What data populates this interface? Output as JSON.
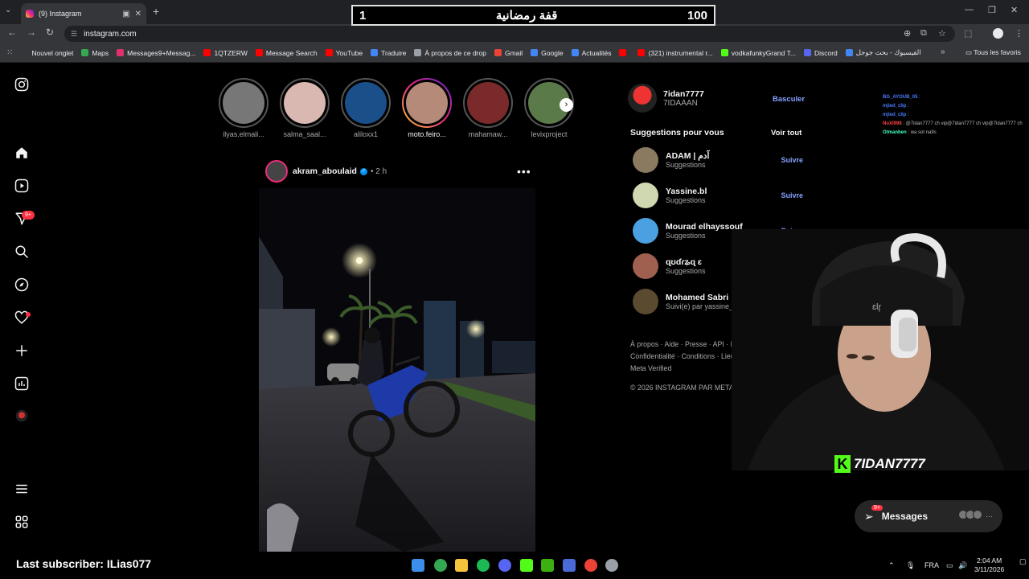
{
  "browser": {
    "tab_title": "(9) Instagram",
    "url": "instagram.com",
    "bookmarks": [
      {
        "label": "Nouvel onglet",
        "color": "#35363a"
      },
      {
        "label": "Maps",
        "color": "#34a853"
      },
      {
        "label": "Messages9+Messag...",
        "color": "#e1306c"
      },
      {
        "label": "1QTZERW",
        "color": "#ff0000"
      },
      {
        "label": "Message Search",
        "color": "#ff0000"
      },
      {
        "label": "YouTube",
        "color": "#ff0000"
      },
      {
        "label": "Traduire",
        "color": "#4285f4"
      },
      {
        "label": "À propos de ce drop",
        "color": "#9aa0a6"
      },
      {
        "label": "Gmail",
        "color": "#ea4335"
      },
      {
        "label": "Google",
        "color": "#4285f4"
      },
      {
        "label": "Actualités",
        "color": "#4285f4"
      },
      {
        "label": "",
        "color": "#ff0000"
      },
      {
        "label": "(321) instrumental r...",
        "color": "#ff0000"
      },
      {
        "label": "vodkafunkyGrand T...",
        "color": "#53fc18"
      },
      {
        "label": "Discord",
        "color": "#5865f2"
      },
      {
        "label": "الفيسبوك - بحث جوجل",
        "color": "#4285f4"
      }
    ],
    "all_bookmarks": "Tous les favoris"
  },
  "overlay": {
    "goal_left": "1",
    "goal_title": "قفة رمضانية",
    "goal_right": "100",
    "last_subscriber": "Last subscriber: ILias077",
    "streamer_name": "7IDAN7777"
  },
  "sidebar": {
    "notif_badge": "9+"
  },
  "stories": [
    {
      "name": "ilyas.elmali...",
      "active": false,
      "color": "#777"
    },
    {
      "name": "salma_saal...",
      "active": false,
      "color": "#d8b8b0"
    },
    {
      "name": "aliloxx1",
      "active": false,
      "color": "#1b4f8a"
    },
    {
      "name": "moto.feiro...",
      "active": true,
      "color": "#b58a78"
    },
    {
      "name": "mahamaw...",
      "active": false,
      "color": "#7a2a2a"
    },
    {
      "name": "levixproject",
      "active": false,
      "color": "#5a7a4a"
    }
  ],
  "post": {
    "username": "akram_aboulaid",
    "time": "2 h"
  },
  "profile": {
    "username": "7idan7777",
    "fullname": "7IDAAAN",
    "switch": "Basculer"
  },
  "suggestions": {
    "title": "Suggestions pour vous",
    "see_all": "Voir tout",
    "items": [
      {
        "name": "ADAM | آدم",
        "sub": "Suggestions",
        "color": "#8a7a60"
      },
      {
        "name": "Yassine.bl",
        "sub": "Suggestions",
        "color": "#cfd8b0"
      },
      {
        "name": "Mourad elhayssouf",
        "sub": "Suggestions",
        "color": "#4aa0e0"
      },
      {
        "name": "ɋʊɗɾʑɋ ɛ",
        "sub": "Suggestions",
        "color": "#a06050"
      },
      {
        "name": "Mohamed Sabri",
        "sub": "Suivi(e) par yassine_alahian +",
        "color": "#5a4a30"
      }
    ],
    "follow": "Suivre"
  },
  "footer": {
    "links": "À propos · Aide · Presse · API · Emplois · Confidentialité · Conditions · Lieux · Langue · Meta Verified",
    "copyright": "© 2026 INSTAGRAM PAR META"
  },
  "chat": [
    {
      "user": "BG_AYOUB_05",
      "msg": "",
      "cls": "n1"
    },
    {
      "user": "mjied_clip",
      "msg": "",
      "cls": "n1"
    },
    {
      "user": "mjied_clip",
      "msg": "",
      "cls": "n1"
    },
    {
      "user": "NoXI998",
      "msg": "@7idan7777 ch vip@7idan7777 ch vip@7idan7777 ch",
      "cls": "n2"
    },
    {
      "user": "Otmanben",
      "msg": "wa sot na9s",
      "cls": "n3"
    }
  ],
  "messages_pill": {
    "label": "Messages",
    "badge": "9+"
  },
  "taskbar": {
    "lang": "FRA",
    "time": "2:04 AM",
    "date": "3/11/2026"
  }
}
